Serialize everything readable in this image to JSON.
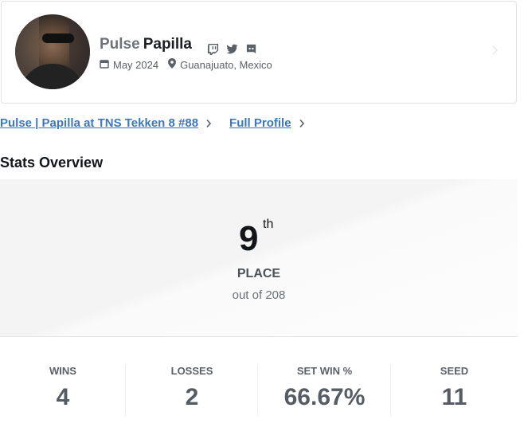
{
  "profile": {
    "prefix": "Pulse",
    "gamer_tag": "Papilla",
    "joined": "May 2024",
    "location": "Guanajuato, Mexico",
    "socials": [
      "twitch-icon",
      "twitter-icon",
      "discord-icon"
    ]
  },
  "links": {
    "event_link": "Pulse | Papilla at TNS Tekken 8 #88",
    "full_profile": "Full Profile"
  },
  "section_title": "Stats Overview",
  "placement": {
    "number": "9",
    "suffix": "th",
    "label": "PLACE",
    "out_of": "out of 208"
  },
  "stats": [
    {
      "label": "WINS",
      "value": "4"
    },
    {
      "label": "LOSSES",
      "value": "2"
    },
    {
      "label": "SET WIN %",
      "value": "66.67%"
    },
    {
      "label": "SEED",
      "value": "11"
    }
  ],
  "colors": {
    "link": "#3a78c2",
    "muted": "#5b6168",
    "panel": "#f4f4f5"
  }
}
